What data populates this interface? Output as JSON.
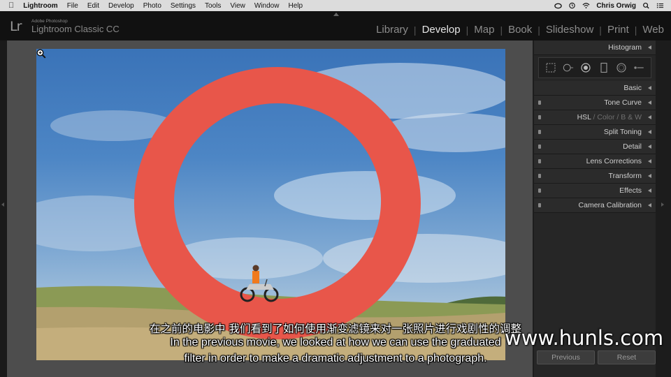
{
  "menubar": {
    "app_name": "Lightroom",
    "items": [
      "File",
      "Edit",
      "Develop",
      "Photo",
      "Settings",
      "Tools",
      "View",
      "Window",
      "Help"
    ],
    "user": "Chris Orwig"
  },
  "app": {
    "logo": "Lr",
    "brand_small": "Adobe Photoshop",
    "brand_big": "Lightroom Classic CC"
  },
  "modules": {
    "items": [
      "Library",
      "Develop",
      "Map",
      "Book",
      "Slideshow",
      "Print",
      "Web"
    ],
    "active": "Develop"
  },
  "right_panel": {
    "histogram": "Histogram",
    "panels": [
      "Basic",
      "Tone Curve",
      "Split Toning",
      "Detail",
      "Lens Corrections",
      "Transform",
      "Effects",
      "Camera Calibration"
    ],
    "hsl": {
      "hsl": "HSL",
      "sep": "/",
      "color": "Color",
      "bw": "B & W"
    },
    "previous_label": "Previous",
    "reset_label": "Reset"
  },
  "subtitles": {
    "cn": "在之前的电影中 我们看到了如何使用渐变滤镜来对一张照片进行戏剧性的调整",
    "en_line1": "In the previous movie, we looked at how we can use the graduated",
    "en_line2": "filter in order to make a dramatic adjustment to a photograph."
  },
  "watermark": "www.hunls.com",
  "colors": {
    "ring": "#e8564a",
    "active_module": "#e6e6e6",
    "panel_bg": "#262626"
  }
}
